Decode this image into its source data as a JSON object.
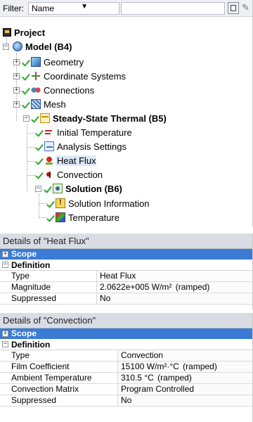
{
  "filter": {
    "label": "Filter:",
    "selected": "Name",
    "search_value": ""
  },
  "tree": {
    "project": "Project",
    "model": "Model (B4)",
    "geometry": "Geometry",
    "coordinate_systems": "Coordinate Systems",
    "connections": "Connections",
    "mesh": "Mesh",
    "analysis": "Steady-State Thermal (B5)",
    "initial_temperature": "Initial Temperature",
    "analysis_settings": "Analysis Settings",
    "heat_flux": "Heat Flux",
    "convection": "Convection",
    "solution": "Solution (B6)",
    "solution_information": "Solution Information",
    "temperature": "Temperature"
  },
  "heat_flux_details": {
    "title": "Details of \"Heat Flux\"",
    "scope": "Scope",
    "definition": "Definition",
    "rows": [
      {
        "name": "Type",
        "value": "Heat Flux",
        "ramp": ""
      },
      {
        "name": "Magnitude",
        "value": "2.0622e+005 W/m²",
        "ramp": "(ramped)"
      },
      {
        "name": "Suppressed",
        "value": "No",
        "ramp": ""
      }
    ]
  },
  "convection_details": {
    "title": "Details of \"Convection\"",
    "scope": "Scope",
    "definition": "Definition",
    "rows": [
      {
        "name": "Type",
        "value": "Convection",
        "ramp": ""
      },
      {
        "name": "Film Coefficient",
        "value": "15100 W/m²·°C",
        "ramp": "(ramped)"
      },
      {
        "name": "Ambient Temperature",
        "value": "310.5 °C",
        "ramp": "(ramped)"
      },
      {
        "name": "Convection Matrix",
        "value": "Program Controlled",
        "ramp": ""
      },
      {
        "name": "Suppressed",
        "value": "No",
        "ramp": ""
      }
    ]
  }
}
